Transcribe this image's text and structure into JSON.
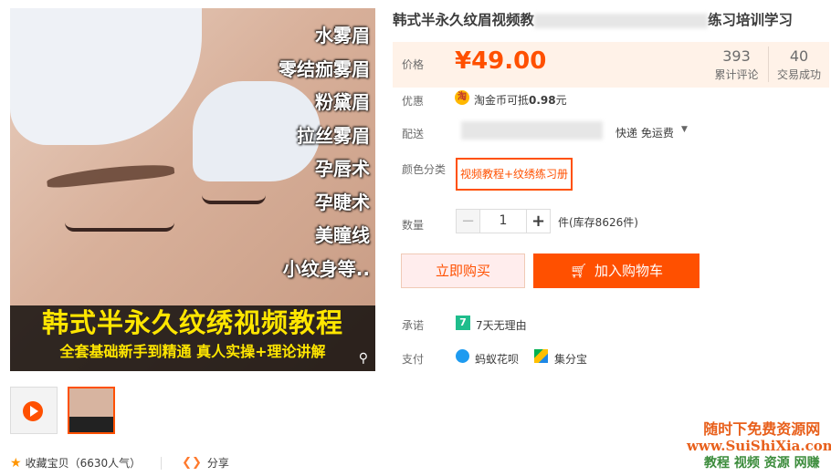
{
  "product": {
    "title_left": "韩式半永久纹眉视频教",
    "title_right": "练习培训学习",
    "image_list": [
      "水雾眉",
      "零结痂雾眉",
      "粉黛眉",
      "拉丝雾眉",
      "孕唇术",
      "孕睫术",
      "美瞳线",
      "小纹身等.."
    ],
    "image_banner_title": "韩式半永久纹绣视频教程",
    "image_banner_subtitle": "全套基础新手到精通 真人实操+理论讲解"
  },
  "price": {
    "label": "价格",
    "value": "¥49.00",
    "reviews_count": "393",
    "reviews_caption": "累计评论",
    "sales_count": "40",
    "sales_caption": "交易成功"
  },
  "promo": {
    "label": "优惠",
    "icon_text": "淘",
    "text_prefix": "淘金币可抵",
    "amount": "0.98",
    "text_suffix": "元"
  },
  "shipping": {
    "label": "配送",
    "value": "快递 免运费"
  },
  "color": {
    "label": "颜色分类",
    "selected": "视频教程+纹绣练习册"
  },
  "quantity": {
    "label": "数量",
    "minus": "−",
    "value": "1",
    "plus": "+",
    "stock_text": "件(库存8626件)"
  },
  "actions": {
    "buy_now": "立即购买",
    "add_to_cart": "加入购物车"
  },
  "promise": {
    "label": "承诺",
    "icon_text": "7",
    "text": "7天无理由"
  },
  "payment": {
    "label": "支付",
    "method1": "蚂蚁花呗",
    "method2": "集分宝"
  },
  "bottom": {
    "favorite": "收藏宝贝（6630人气）",
    "share": "分享"
  },
  "watermark": {
    "line1": "随时下免费资源网",
    "line2": "www.SuiShiXia.com",
    "line3": "教程 视频 资源 网赚"
  },
  "colors": {
    "accent": "#ff5000",
    "price_panel_bg": "#fff2e8"
  }
}
